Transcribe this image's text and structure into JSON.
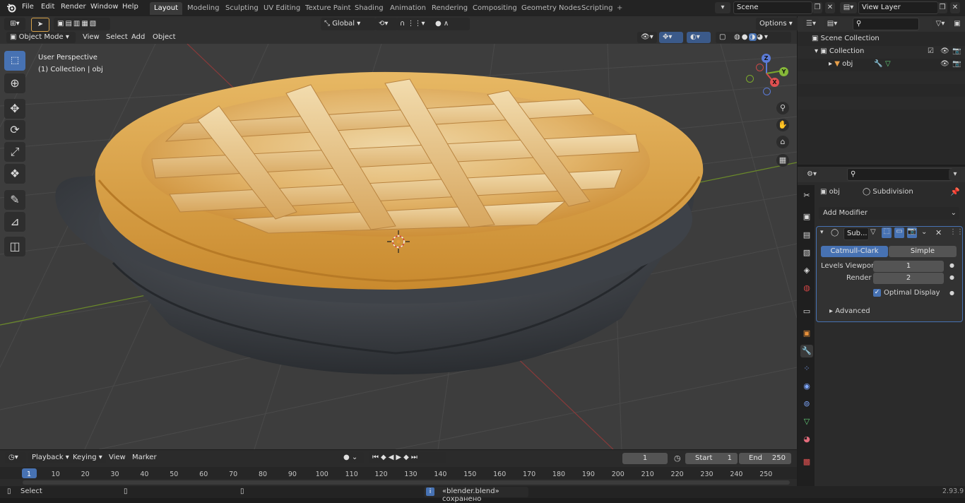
{
  "topbar": {
    "menus": [
      "File",
      "Edit",
      "Render",
      "Window",
      "Help"
    ],
    "workspaces": [
      "Layout",
      "Modeling",
      "Sculpting",
      "UV Editing",
      "Texture Paint",
      "Shading",
      "Animation",
      "Rendering",
      "Compositing",
      "Geometry Nodes",
      "Scripting"
    ],
    "active_workspace": "Layout",
    "add_tab": "+",
    "scene_value": "Scene",
    "view_layer_value": "View Layer"
  },
  "viewport_header": {
    "mode": "Object Mode",
    "menus": [
      "View",
      "Select",
      "Add",
      "Object"
    ],
    "orientation": "Global",
    "options": "Options"
  },
  "viewport": {
    "perspective_label": "User Perspective",
    "collection_label": "(1) Collection | obj",
    "gizmo_axes": {
      "x": "X",
      "y": "Y",
      "z": "Z"
    }
  },
  "outliner": {
    "scene_collection": "Scene Collection",
    "collection": "Collection",
    "object": "obj"
  },
  "properties": {
    "object_name": "obj",
    "modifier_name": "Subdivision",
    "add_modifier": "Add Modifier",
    "modifier_short": "Sub...",
    "catmull": "Catmull-Clark",
    "simple": "Simple",
    "levels_viewport_label": "Levels Viewport",
    "levels_viewport_value": "1",
    "render_label": "Render",
    "render_value": "2",
    "optimal_display": "Optimal Display",
    "advanced": "Advanced"
  },
  "timeline": {
    "menus": [
      "Playback",
      "Keying",
      "View",
      "Marker"
    ],
    "current_frame": "1",
    "start_label": "Start",
    "start_value": "1",
    "end_label": "End",
    "end_value": "250",
    "ticks": [
      "1",
      "10",
      "20",
      "30",
      "40",
      "50",
      "60",
      "70",
      "80",
      "90",
      "100",
      "110",
      "120",
      "130",
      "140",
      "150",
      "160",
      "170",
      "180",
      "190",
      "200",
      "210",
      "220",
      "230",
      "240",
      "250"
    ]
  },
  "statusbar": {
    "select": "Select",
    "message": "«blender.blend» сохранено",
    "version": "2.93.9"
  },
  "colors": {
    "accent": "#4772b3",
    "header_bg": "#303030",
    "viewport_bg": "#3d3d3d"
  }
}
